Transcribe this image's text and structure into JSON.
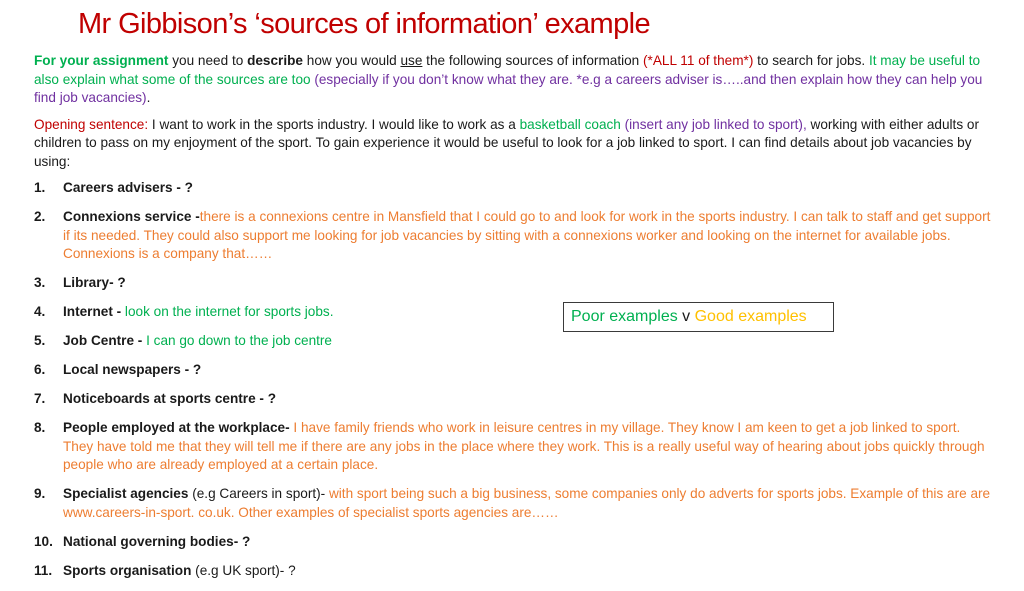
{
  "title": "Mr Gibbison’s ‘sources of information’ example",
  "intro": {
    "lead": "For your assignment",
    "t1": " you need to ",
    "describe": "describe",
    "t2": " how you would ",
    "use": "use",
    "t3": " the following sources of information ",
    "all11": "(*ALL 11 of them*)",
    "t4": " to search for jobs. ",
    "green_part": "It may be useful to also explain what some of the sources are too ",
    "purple_part": "(especially if you don’t know what they are. *e.g a careers adviser is…..and then explain how they can help you find job vacancies)",
    "end": "."
  },
  "opening": {
    "label": "Opening sentence:",
    "t1": " I want to work in the sports industry.  I would like to work as a ",
    "job": "basketball coach",
    "insert": " (insert any job linked to sport),",
    "t2": " working with either adults or children to pass on my enjoyment of the sport.  To gain experience it would be useful to look for a job linked to sport.  I can find details about job vacancies by using:"
  },
  "list": [
    {
      "num": "1.",
      "name": "Careers advisers - ?",
      "extra": "",
      "text": ""
    },
    {
      "num": "2.",
      "name": "Connexions service -",
      "extra": "",
      "text": "there is a connexions centre in Mansfield that I could go to and look for work in the sports industry. I can talk to staff and get support if its needed. They could also support me looking for job vacancies by sitting with a connexions worker and looking on the internet for available jobs. Connexions is a company that……"
    },
    {
      "num": "3.",
      "name": "Library- ?",
      "extra": "",
      "text": ""
    },
    {
      "num": "4.",
      "name": "Internet -",
      "extra": "",
      "text": " look on the internet for sports jobs."
    },
    {
      "num": "5.",
      "name": "Job Centre -",
      "extra": "",
      "text": " I can go down to the job centre"
    },
    {
      "num": "6.",
      "name": "Local newspapers - ?",
      "extra": "",
      "text": ""
    },
    {
      "num": "7.",
      "name": "Noticeboards at sports centre - ?",
      "extra": "",
      "text": ""
    },
    {
      "num": "8.",
      "name": "People employed at the workplace-",
      "extra": "",
      "text": " I have family friends who work in leisure centres in my village. They know I am keen to get a job linked to sport. They have told me that they will tell me if there are any jobs in the place where they work. This is a really useful way of hearing about jobs quickly through people who are already employed at a certain place."
    },
    {
      "num": "9.",
      "name": "Specialist agencies",
      "extra": " (e.g Careers in sport)-",
      "text": " with sport being such a big business, some companies only do adverts for sports jobs. Example of this are are www.careers-in-sport. co.uk. Other examples of specialist sports agencies are……"
    },
    {
      "num": "10.",
      "name": "National governing bodies- ?",
      "extra": "",
      "text": ""
    },
    {
      "num": "11.",
      "name": "Sports organisation",
      "extra": " (e.g UK sport)- ?",
      "text": ""
    }
  ],
  "callout": {
    "poor": "Poor examples",
    "v": " v ",
    "good": "Good examples"
  },
  "colors": {
    "title": "#c00000",
    "green": "#00b050",
    "purple": "#7030a0",
    "orange": "#ed7d31",
    "gold": "#ffc000"
  }
}
